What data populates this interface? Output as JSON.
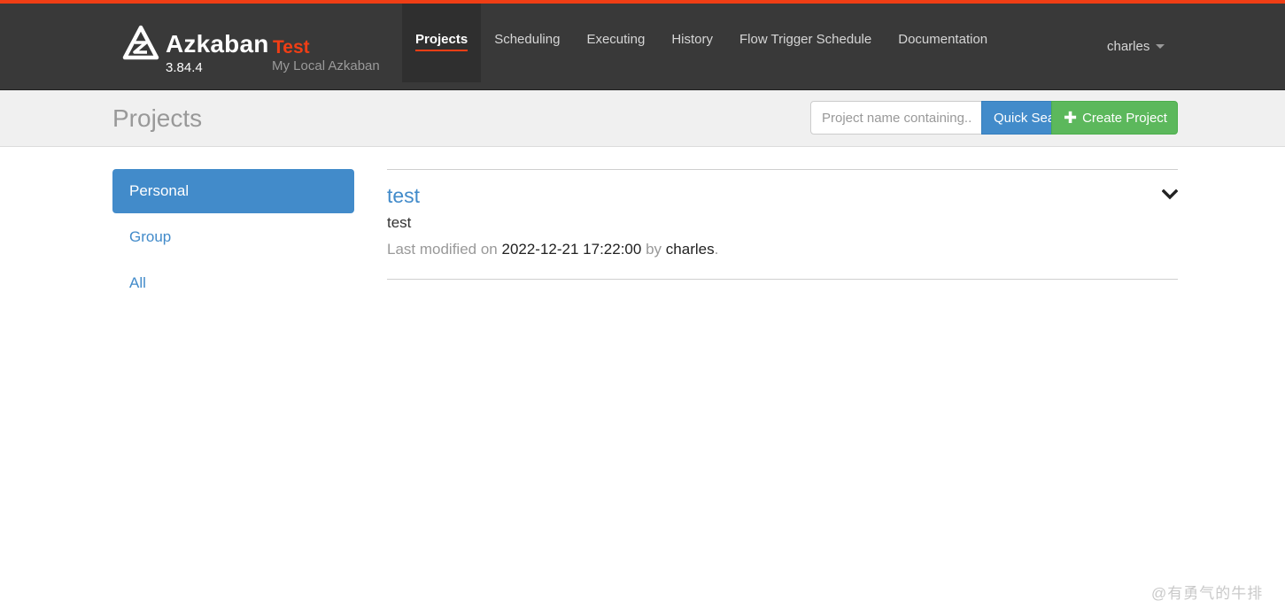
{
  "brand": {
    "name": "Azkaban",
    "env": "Test",
    "version": "3.84.4",
    "subtitle": "My Local Azkaban",
    "accent_color": "#f03e15"
  },
  "nav": {
    "items": [
      {
        "label": "Projects",
        "active": true
      },
      {
        "label": "Scheduling"
      },
      {
        "label": "Executing"
      },
      {
        "label": "History"
      },
      {
        "label": "Flow Trigger Schedule"
      },
      {
        "label": "Documentation"
      }
    ],
    "user": "charles"
  },
  "header": {
    "title": "Projects",
    "search_placeholder": "Project name containing..",
    "quick_search_label": "Quick Search",
    "create_label": "Create Project"
  },
  "side_menu": {
    "items": [
      {
        "label": "Personal",
        "active": true
      },
      {
        "label": "Group"
      },
      {
        "label": "All"
      }
    ]
  },
  "projects": [
    {
      "name": "test",
      "description": "test",
      "modified_prefix": "Last modified on",
      "modified_time": "2022-12-21 17:22:00",
      "by_label": "by",
      "modified_by": "charles",
      "suffix": "."
    }
  ],
  "watermark": "@有勇气的牛排"
}
